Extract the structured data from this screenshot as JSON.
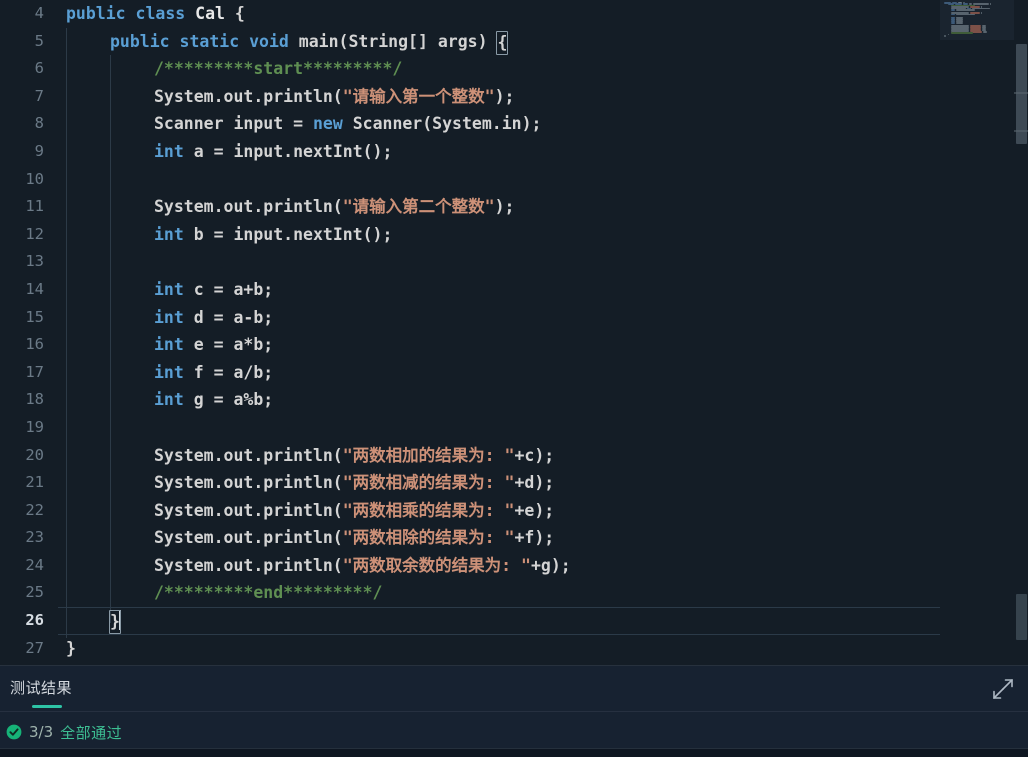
{
  "editor": {
    "language": "java",
    "first_visible_line": 4,
    "active_line": 26,
    "colors": {
      "background": "#141d26",
      "keyword": "#5a9fd4",
      "string": "#cd9178",
      "comment": "#5f8f52",
      "plain": "#d4d4d4",
      "line_number": "#6b7a87",
      "accent": "#2ec4a6",
      "success": "#3dbf93"
    },
    "lines": [
      {
        "num": "4",
        "indent": 0,
        "tokens": [
          {
            "t": "public ",
            "c": "kw"
          },
          {
            "t": "class ",
            "c": "kw"
          },
          {
            "t": "Cal ",
            "c": "cls"
          },
          {
            "t": "{",
            "c": "punc"
          }
        ]
      },
      {
        "num": "5",
        "indent": 1,
        "tokens": [
          {
            "t": "public ",
            "c": "kw"
          },
          {
            "t": "static ",
            "c": "kw"
          },
          {
            "t": "void ",
            "c": "kw"
          },
          {
            "t": "main",
            "c": "plain"
          },
          {
            "t": "(String[] args) ",
            "c": "plain"
          },
          {
            "t": "{",
            "c": "punc",
            "bracket_match": true
          }
        ]
      },
      {
        "num": "6",
        "indent": 2,
        "tokens": [
          {
            "t": "/*********start*********/",
            "c": "cmt"
          }
        ]
      },
      {
        "num": "7",
        "indent": 2,
        "tokens": [
          {
            "t": "System.out.println(",
            "c": "plain"
          },
          {
            "t": "\"请输入第一个整数\"",
            "c": "str"
          },
          {
            "t": ");",
            "c": "plain"
          }
        ]
      },
      {
        "num": "8",
        "indent": 2,
        "tokens": [
          {
            "t": "Scanner input = ",
            "c": "plain"
          },
          {
            "t": "new ",
            "c": "kw"
          },
          {
            "t": "Scanner(System.in);",
            "c": "plain"
          }
        ]
      },
      {
        "num": "9",
        "indent": 2,
        "tokens": [
          {
            "t": "int ",
            "c": "type"
          },
          {
            "t": "a = input.nextInt();",
            "c": "plain"
          }
        ]
      },
      {
        "num": "10",
        "indent": 0,
        "tokens": []
      },
      {
        "num": "11",
        "indent": 2,
        "tokens": [
          {
            "t": "System.out.println(",
            "c": "plain"
          },
          {
            "t": "\"请输入第二个整数\"",
            "c": "str"
          },
          {
            "t": ");",
            "c": "plain"
          }
        ]
      },
      {
        "num": "12",
        "indent": 2,
        "tokens": [
          {
            "t": "int ",
            "c": "type"
          },
          {
            "t": "b = input.nextInt();",
            "c": "plain"
          }
        ]
      },
      {
        "num": "13",
        "indent": 0,
        "tokens": []
      },
      {
        "num": "14",
        "indent": 2,
        "tokens": [
          {
            "t": "int ",
            "c": "type"
          },
          {
            "t": "c = a+b;",
            "c": "plain"
          }
        ]
      },
      {
        "num": "15",
        "indent": 2,
        "tokens": [
          {
            "t": "int ",
            "c": "type"
          },
          {
            "t": "d = a-b;",
            "c": "plain"
          }
        ]
      },
      {
        "num": "16",
        "indent": 2,
        "tokens": [
          {
            "t": "int ",
            "c": "type"
          },
          {
            "t": "e = a*b;",
            "c": "plain"
          }
        ]
      },
      {
        "num": "17",
        "indent": 2,
        "tokens": [
          {
            "t": "int ",
            "c": "type"
          },
          {
            "t": "f = a/b;",
            "c": "plain"
          }
        ]
      },
      {
        "num": "18",
        "indent": 2,
        "tokens": [
          {
            "t": "int ",
            "c": "type"
          },
          {
            "t": "g = a%b;",
            "c": "plain"
          }
        ]
      },
      {
        "num": "19",
        "indent": 0,
        "tokens": []
      },
      {
        "num": "20",
        "indent": 2,
        "tokens": [
          {
            "t": "System.out.println(",
            "c": "plain"
          },
          {
            "t": "\"两数相加的结果为: \"",
            "c": "str"
          },
          {
            "t": "+c);",
            "c": "plain"
          }
        ]
      },
      {
        "num": "21",
        "indent": 2,
        "tokens": [
          {
            "t": "System.out.println(",
            "c": "plain"
          },
          {
            "t": "\"两数相减的结果为: \"",
            "c": "str"
          },
          {
            "t": "+d);",
            "c": "plain"
          }
        ]
      },
      {
        "num": "22",
        "indent": 2,
        "tokens": [
          {
            "t": "System.out.println(",
            "c": "plain"
          },
          {
            "t": "\"两数相乘的结果为: \"",
            "c": "str"
          },
          {
            "t": "+e);",
            "c": "plain"
          }
        ]
      },
      {
        "num": "23",
        "indent": 2,
        "tokens": [
          {
            "t": "System.out.println(",
            "c": "plain"
          },
          {
            "t": "\"两数相除的结果为: \"",
            "c": "str"
          },
          {
            "t": "+f);",
            "c": "plain"
          }
        ]
      },
      {
        "num": "24",
        "indent": 2,
        "tokens": [
          {
            "t": "System.out.println(",
            "c": "plain"
          },
          {
            "t": "\"两数取余数的结果为: \"",
            "c": "str"
          },
          {
            "t": "+g);",
            "c": "plain"
          }
        ]
      },
      {
        "num": "25",
        "indent": 2,
        "tokens": [
          {
            "t": "/*********end*********/",
            "c": "cmt"
          }
        ]
      },
      {
        "num": "26",
        "indent": 1,
        "active": true,
        "tokens": [
          {
            "t": "}",
            "c": "punc",
            "bracket_match": true,
            "cursor_after": true
          }
        ]
      },
      {
        "num": "27",
        "indent": 0,
        "tokens": [
          {
            "t": "}",
            "c": "punc"
          }
        ]
      }
    ]
  },
  "panel": {
    "tab_label": "测试结果",
    "expand_icon": "expand-diagonal-icon",
    "result": {
      "status_icon": "check-circle-icon",
      "count": "3/3",
      "label": "全部通过"
    }
  }
}
